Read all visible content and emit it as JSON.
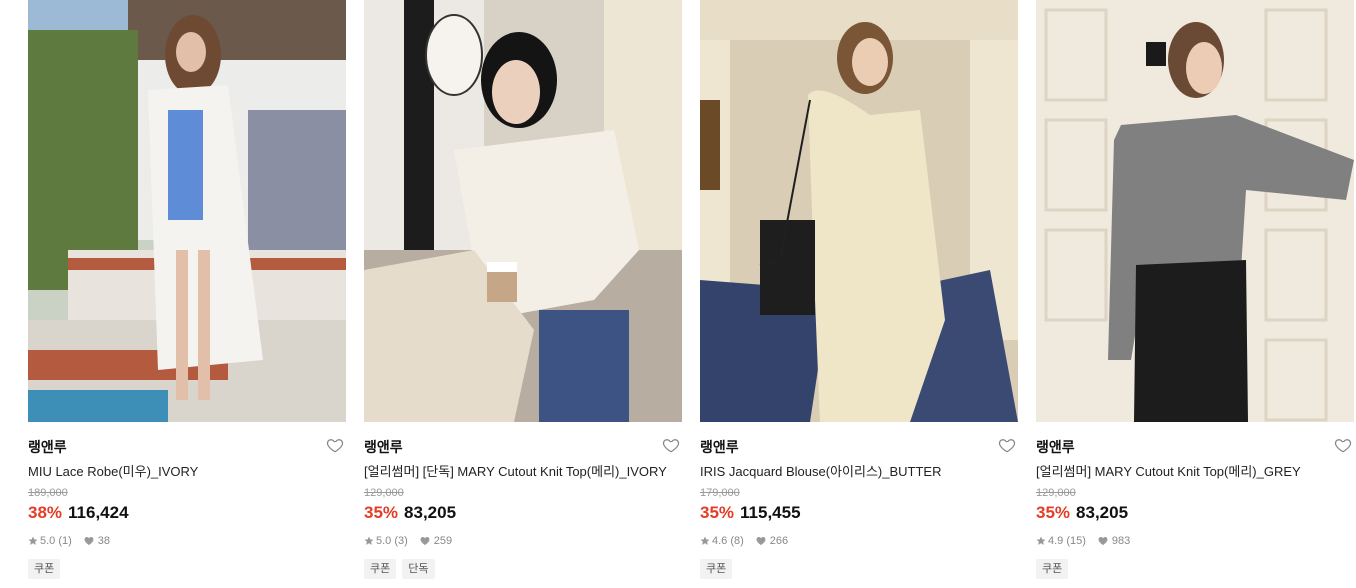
{
  "products": [
    {
      "brand": "랭앤루",
      "name": "MIU Lace Robe(미우)_IVORY",
      "original_price": "189,000",
      "discount": "38%",
      "price": "116,424",
      "rating": "5.0 (1)",
      "likes": "38",
      "tags": [
        "쿠폰"
      ]
    },
    {
      "brand": "랭앤루",
      "name": "[얼리썸머] [단독] MARY Cutout Knit Top(메리)_IVORY",
      "original_price": "129,000",
      "discount": "35%",
      "price": "83,205",
      "rating": "5.0 (3)",
      "likes": "259",
      "tags": [
        "쿠폰",
        "단독"
      ]
    },
    {
      "brand": "랭앤루",
      "name": "IRIS Jacquard Blouse(아이리스)_BUTTER",
      "original_price": "179,000",
      "discount": "35%",
      "price": "115,455",
      "rating": "4.6 (8)",
      "likes": "266",
      "tags": [
        "쿠폰"
      ]
    },
    {
      "brand": "랭앤루",
      "name": "[얼리썸머] MARY Cutout Knit Top(메리)_GREY",
      "original_price": "129,000",
      "discount": "35%",
      "price": "83,205",
      "rating": "4.9 (15)",
      "likes": "983",
      "tags": [
        "쿠폰"
      ]
    }
  ],
  "icons": {
    "like": "heart-outline-icon",
    "rating": "star-icon",
    "likes_count": "heart-filled-icon"
  },
  "colors": {
    "discount": "#e43c25",
    "tag_bg": "#f2f2f2",
    "muted": "#999999"
  }
}
